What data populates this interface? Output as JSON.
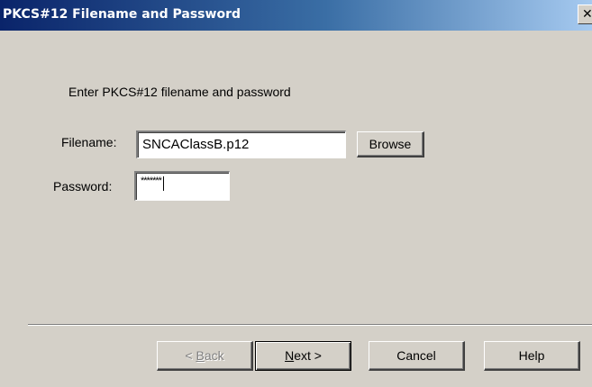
{
  "window": {
    "title": "PKCS#12 Filename and Password",
    "close_glyph": "✕"
  },
  "form": {
    "instruction": "Enter PKCS#12 filename and password",
    "filename_label": "Filename:",
    "filename_value": "SNCAClassB.p12",
    "password_label": "Password:",
    "password_value": "*******",
    "browse_label": "Browse"
  },
  "footer": {
    "back_prefix": "< ",
    "back_mnemonic": "B",
    "back_rest": "ack",
    "next_mnemonic": "N",
    "next_rest": "ext >",
    "cancel_label": "Cancel",
    "help_label": "Help"
  },
  "colors": {
    "title_gradient_start": "#0a246a",
    "title_gradient_end": "#a6caf0",
    "dialog_face": "#d4d0c8"
  }
}
